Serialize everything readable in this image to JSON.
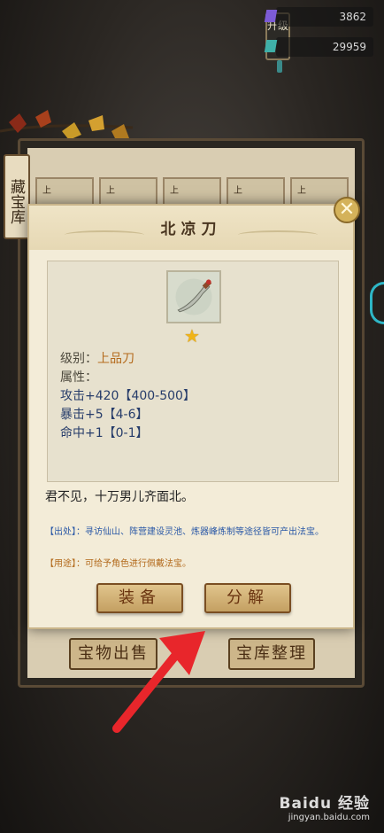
{
  "currency": {
    "gem_purple": {
      "icon": "purple-gem-icon",
      "value": "3862",
      "color": "#7c5bd6"
    },
    "gem_teal": {
      "icon": "teal-gem-icon",
      "value": "29959",
      "color": "#3fb0a8"
    }
  },
  "lantern": {
    "text": "升级"
  },
  "treasury": {
    "side_tag": "藏宝库",
    "sell_button": "宝物出售",
    "organize_button": "宝库整理",
    "slot_labels": [
      "上",
      "上",
      "上",
      "上",
      "上"
    ]
  },
  "modal": {
    "title": "北凉刀",
    "item_icon": "dagger-icon",
    "rating": "1 star",
    "grade_label": "级别：",
    "grade_value": "上品刀",
    "attr_title": "属性：",
    "attrs": [
      "攻击+420【400-500】",
      "暴击+5【4-6】",
      "命中+1【0-1】"
    ],
    "description": "君不见，十万男儿齐面北。",
    "source": "【出处】：寻访仙山、阵营建设灵池、炼器峰炼制等途径皆可产出法宝。",
    "usage": "【用途】：可给予角色进行佩戴法宝。",
    "equip_button": "装备",
    "decompose_button": "分解",
    "close_icon": "close-icon"
  },
  "watermark": {
    "title": "Baidu 经验",
    "url": "jingyan.baidu.com"
  },
  "colors": {
    "grade": "#b46a1c",
    "attr": "#263c6a",
    "source": "#2a58a6",
    "usage": "#b36a1c",
    "arrow": "#e8262b"
  }
}
